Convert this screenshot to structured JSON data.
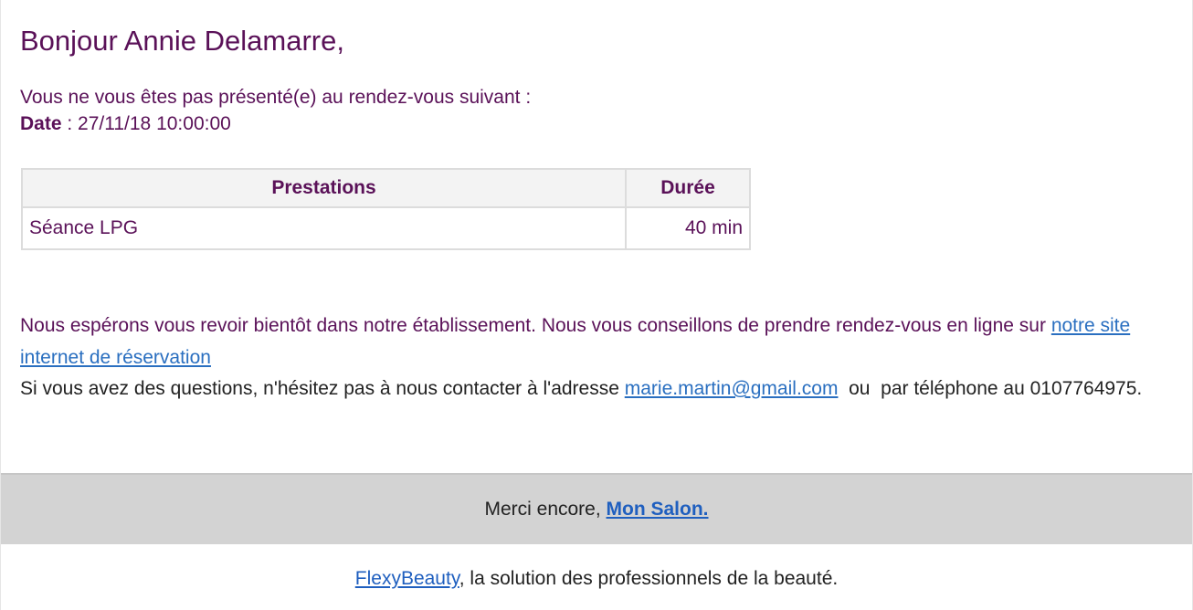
{
  "email": {
    "greeting": "Bonjour Annie Delamarre,",
    "intro": "Vous ne vous êtes pas présenté(e) au rendez-vous suivant :",
    "date_label": "Date",
    "date_separator": " : ",
    "date_value": "27/11/18 10:00:00",
    "table": {
      "headers": {
        "service": "Prestations",
        "duration": "Durée"
      },
      "rows": [
        {
          "service": "Séance LPG",
          "duration": "40 min"
        }
      ]
    },
    "closing_text": "Nous espérons vous revoir bientôt dans notre établissement. Nous vous conseillons de prendre rendez-vous en ligne sur ",
    "booking_link": "notre site internet de réservation",
    "contact_text_before": "Si vous avez des questions, n'hésitez pas à nous contacter à l'adresse ",
    "contact_email": "marie.martin@gmail.com",
    "contact_text_after": "  ou  par téléphone au 0107764975."
  },
  "thanks": {
    "text": "Merci encore, ",
    "salon_link": "Mon Salon."
  },
  "footer": {
    "brand_link": "FlexyBeauty",
    "tagline": ", la solution des professionnels de la beauté."
  },
  "colors": {
    "primary_text": "#5a1158",
    "link": "#2a6fc0",
    "band_background": "#d3d3d3"
  }
}
